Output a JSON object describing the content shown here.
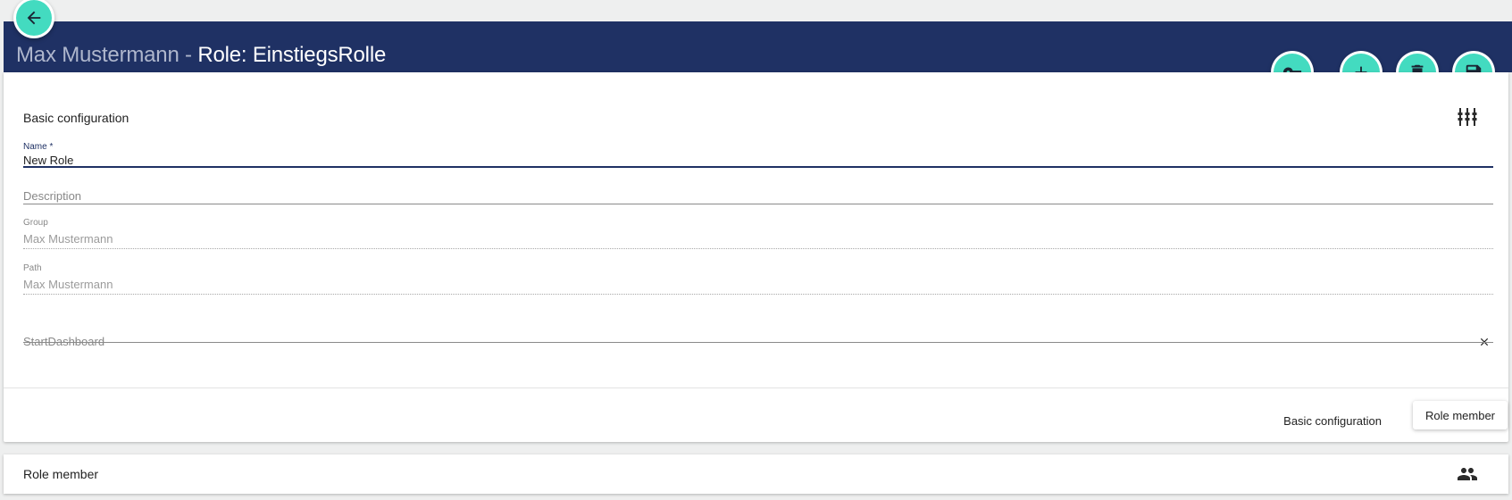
{
  "header": {
    "owner": "Max Mustermann",
    "separator": " - ",
    "role_title": "Role: EinstiegsRolle"
  },
  "actions": {
    "back": "arrow-left-icon",
    "key": "key-icon",
    "add": "plus-icon",
    "delete": "trash-icon",
    "save": "floppy-disk-icon"
  },
  "basic_config": {
    "title": "Basic configuration",
    "fields": {
      "name": {
        "label": "Name *",
        "value": "New Role"
      },
      "description": {
        "placeholder": "Description"
      },
      "group": {
        "label": "Group",
        "value": "Max Mustermann"
      },
      "path": {
        "label": "Path",
        "value": "Max Mustermann"
      },
      "start_dashboard": {
        "placeholder": "StartDashboard"
      }
    },
    "tabs": {
      "basic": "Basic configuration",
      "member": "Role member"
    }
  },
  "role_member": {
    "title": "Role member"
  },
  "colors": {
    "header_bg": "#1f3164",
    "accent": "#43dbc0",
    "background": "#eeefef"
  }
}
